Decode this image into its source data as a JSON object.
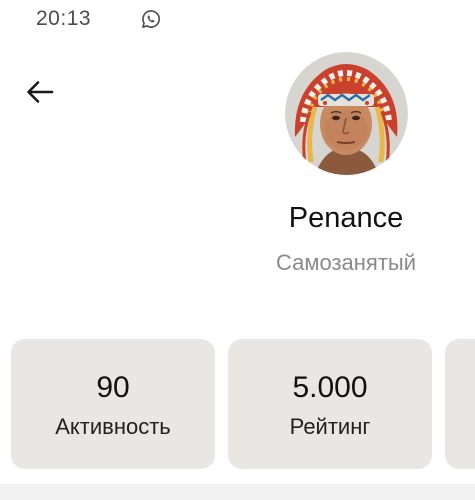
{
  "status_bar": {
    "time": "20:13",
    "notification_icon": "whatsapp-icon"
  },
  "header": {
    "back_icon": "arrow-left-icon"
  },
  "profile": {
    "name": "Penance",
    "status": "Самозанятый"
  },
  "stats": [
    {
      "value": "90",
      "label": "Активность"
    },
    {
      "value": "5.000",
      "label": "Рейтинг"
    },
    {
      "value": "",
      "label": ""
    }
  ],
  "colors": {
    "card_background": "#e8e7e4",
    "secondary_text": "#8a8a8a"
  }
}
